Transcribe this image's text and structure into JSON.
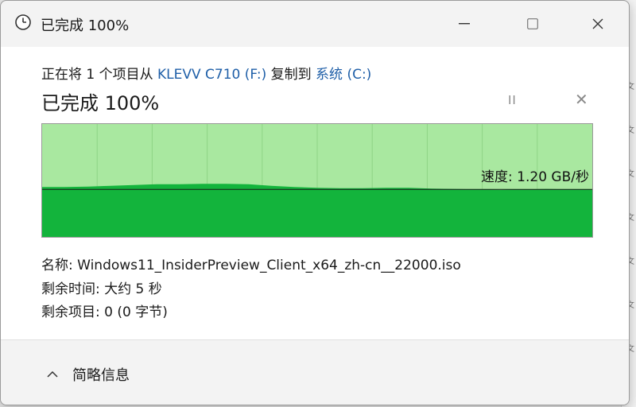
{
  "window": {
    "title": "已完成 100%",
    "minimize": "—",
    "maximize": "☐",
    "close": "✕"
  },
  "copy": {
    "prefix": "正在将 1 个项目从 ",
    "source": "KLEVV C710 (F:)",
    "middle": " 复制到 ",
    "destination": "系统 (C:)"
  },
  "progress": {
    "title": "已完成 100%",
    "percent": 100,
    "pause": "II",
    "stop": "✕"
  },
  "graph": {
    "speed_label": "速度: 1.20 GB/秒",
    "speed_series": [
      1.26,
      1.26,
      1.27,
      1.29,
      1.31,
      1.33,
      1.33,
      1.34,
      1.34,
      1.33,
      1.29,
      1.26,
      1.24,
      1.23,
      1.23,
      1.24,
      1.24,
      1.22,
      1.21,
      1.2,
      1.19,
      1.2,
      1.21,
      1.2,
      1.2
    ],
    "current_speed": 1.2,
    "colors": {
      "fill": "#13b43c",
      "background": "#a9e8a0",
      "grid": "#8fd486",
      "line": "#1a1a1a"
    }
  },
  "details": {
    "name_label": "名称: ",
    "name_value": "Windows11_InsiderPreview_Client_x64_zh-cn__22000.iso",
    "time_label": "剩余时间: ",
    "time_value": "大约 5 秒",
    "items_label": "剩余项目: ",
    "items_value": "0 (0 字节)"
  },
  "footer": {
    "toggle_label": "简略信息"
  },
  "background": {
    "right_glyph": "文"
  }
}
